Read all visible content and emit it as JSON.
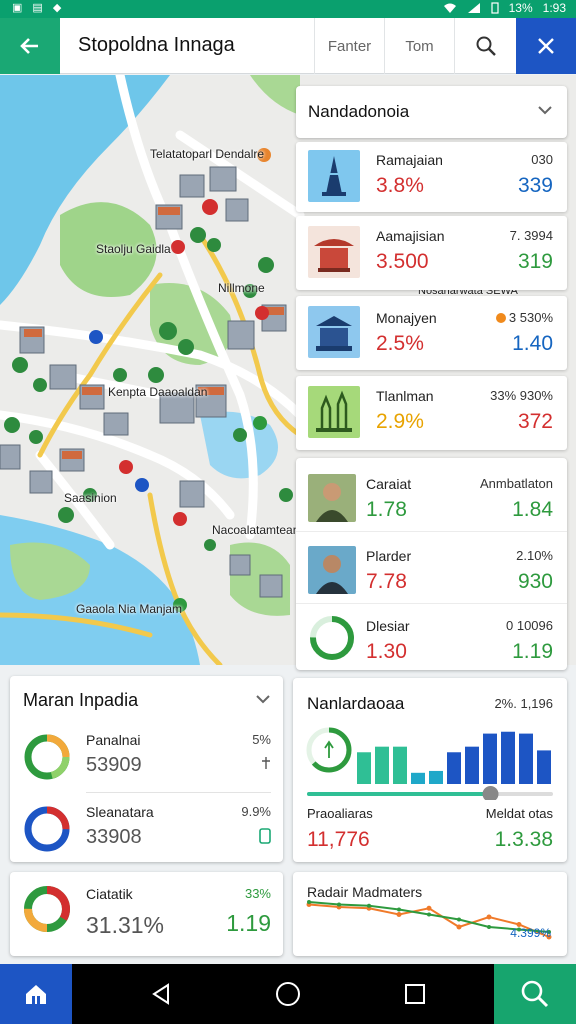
{
  "status_bar": {
    "left_glyphs": [
      "▣",
      "▤",
      "◆"
    ],
    "battery": "13%",
    "time": "1:93"
  },
  "app_bar": {
    "title": "Stopoldna Innaga",
    "filter_label": "Fanter",
    "tom_label": "Tom"
  },
  "map": {
    "labels": [
      "Telatatoparl Dendalre",
      "Staolju Gaidla",
      "Nillmone",
      "Kenpta Daaoaldan",
      "Saasinion",
      "Nacoalatamtean",
      "Gaaola Nia Manjam",
      "Nosaharwata SEWA"
    ]
  },
  "list_panel": {
    "title": "Nandadonoia",
    "rows": [
      {
        "name": "Ramajaian",
        "value": "3.8%",
        "top_right": "030",
        "bottom_right": "339",
        "color": "#d32f2f",
        "br_color": "#1565c0"
      },
      {
        "name": "Aamajisian",
        "value": "3.500",
        "top_right": "7. 3994",
        "bottom_right": "319",
        "color": "#d32f2f",
        "br_color": "#2e9a3e"
      },
      {
        "name": "Monajyen",
        "value": "2.5%",
        "top_right": "3 530%",
        "bottom_right": "1.40",
        "color": "#d32f2f",
        "br_color": "#1565c0"
      },
      {
        "name": "Tlanlman",
        "value": "2.9%",
        "top_right": "33% 930%",
        "bottom_right": "372",
        "color": "#e8a300",
        "br_color": "#d32f2f"
      }
    ]
  },
  "people_panel": {
    "rows": [
      {
        "name": "Caraiat",
        "value": "1.78",
        "top_right": "Anmbatlaton",
        "bottom_right": "1.84"
      },
      {
        "name": "Plarder",
        "value": "7.78",
        "top_right": "2.10%",
        "bottom_right": "930"
      },
      {
        "name": "Dlesiar",
        "value": "1.30",
        "top_right": "0 10096",
        "bottom_right": "1.19"
      }
    ]
  },
  "summary_card": {
    "title": "Maran Inpadia",
    "rows": [
      {
        "name": "Panalnai",
        "value": "53909",
        "top_right": "5%"
      },
      {
        "name": "Sleanatara",
        "value": "33908",
        "top_right": "9.9%"
      }
    ]
  },
  "stat_card": {
    "name": "Ciatatik",
    "value": "31.31%",
    "top_right": "33%",
    "bottom_right": "1.19"
  },
  "chart_card": {
    "title": "Nanlardaoaa",
    "top_right": "2%. 1,196",
    "left_name": "Praoaliaras",
    "left_value": "11,776",
    "right_name": "Meldat otas",
    "right_value": "1.3.38"
  },
  "line_card": {
    "title": "Radair Madmaters",
    "tag": "4.399%"
  },
  "chart_data": [
    {
      "type": "bar",
      "values": [
        34,
        40,
        40,
        12,
        14,
        34,
        40,
        54,
        56,
        54,
        36
      ],
      "colors": [
        "#2fbf95",
        "#2fbf95",
        "#2fbf95",
        "#1fa8c9",
        "#1fa8c9",
        "#1d55c4",
        "#1d55c4",
        "#1d55c4",
        "#1d55c4",
        "#1d55c4",
        "#1d55c4"
      ],
      "slider_value": 0.75,
      "ylim": [
        0,
        60
      ]
    },
    {
      "type": "line",
      "series": [
        {
          "values": [
            30,
            28,
            27,
            22,
            27,
            12,
            20,
            14,
            4
          ],
          "color": "#f07a2a"
        },
        {
          "values": [
            32,
            30,
            29,
            26,
            22,
            18,
            12,
            10,
            8
          ],
          "color": "#2e9a3e"
        }
      ],
      "ylim": [
        0,
        40
      ]
    }
  ],
  "colors": {
    "brand_green": "#1aa874",
    "brand_blue": "#1d55c4",
    "status_green": "#0aa06e"
  }
}
